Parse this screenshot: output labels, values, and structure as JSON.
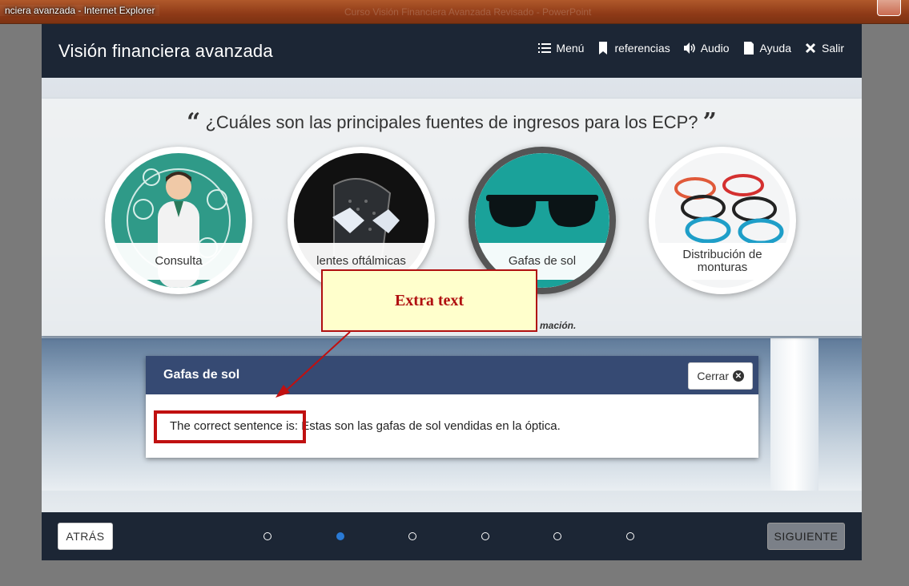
{
  "window": {
    "title": "nciera avanzada - Internet Explorer",
    "faint_title": "Curso Visión Financiera Avanzada Revisado - PowerPoint"
  },
  "header": {
    "title": "Visión financiera avanzada",
    "nav": [
      {
        "label": "Menú",
        "icon": "menu-icon"
      },
      {
        "label": "referencias",
        "icon": "bookmark-icon"
      },
      {
        "label": "Audio",
        "icon": "speaker-icon"
      },
      {
        "label": "Ayuda",
        "icon": "document-icon"
      },
      {
        "label": "Salir",
        "icon": "close-icon"
      }
    ]
  },
  "question": {
    "open_quote": "“",
    "text": "¿Cuáles son las principales fuentes de ingresos para los ECP?",
    "close_quote": "”"
  },
  "options": [
    {
      "label": "Consulta",
      "icon": "doctor-icon",
      "active": false
    },
    {
      "label": "lentes oftálmicas",
      "icon": "lens-icon",
      "active": false
    },
    {
      "label": "Gafas de sol",
      "icon": "sunglasses-icon",
      "active": true
    },
    {
      "label": "Distribución de monturas",
      "icon": "frames-icon",
      "active": false
    }
  ],
  "hint_fragment": "mación.",
  "callout": {
    "text": "Extra text"
  },
  "dialog": {
    "title": "Gafas de sol",
    "close_label": "Cerrar",
    "body": "The correct sentence is: Estas son las gafas de sol vendidas en la óptica."
  },
  "footer": {
    "back_label": "ATRÁS",
    "next_label": "SIGUIENTE",
    "dots_total": 6,
    "active_dot": 2
  },
  "colors": {
    "header_bg": "#1c2635",
    "dialog_header": "#364a73",
    "teal": "#1aa29a",
    "callout_red": "#b01010",
    "dot_active": "#2a7ad5"
  }
}
